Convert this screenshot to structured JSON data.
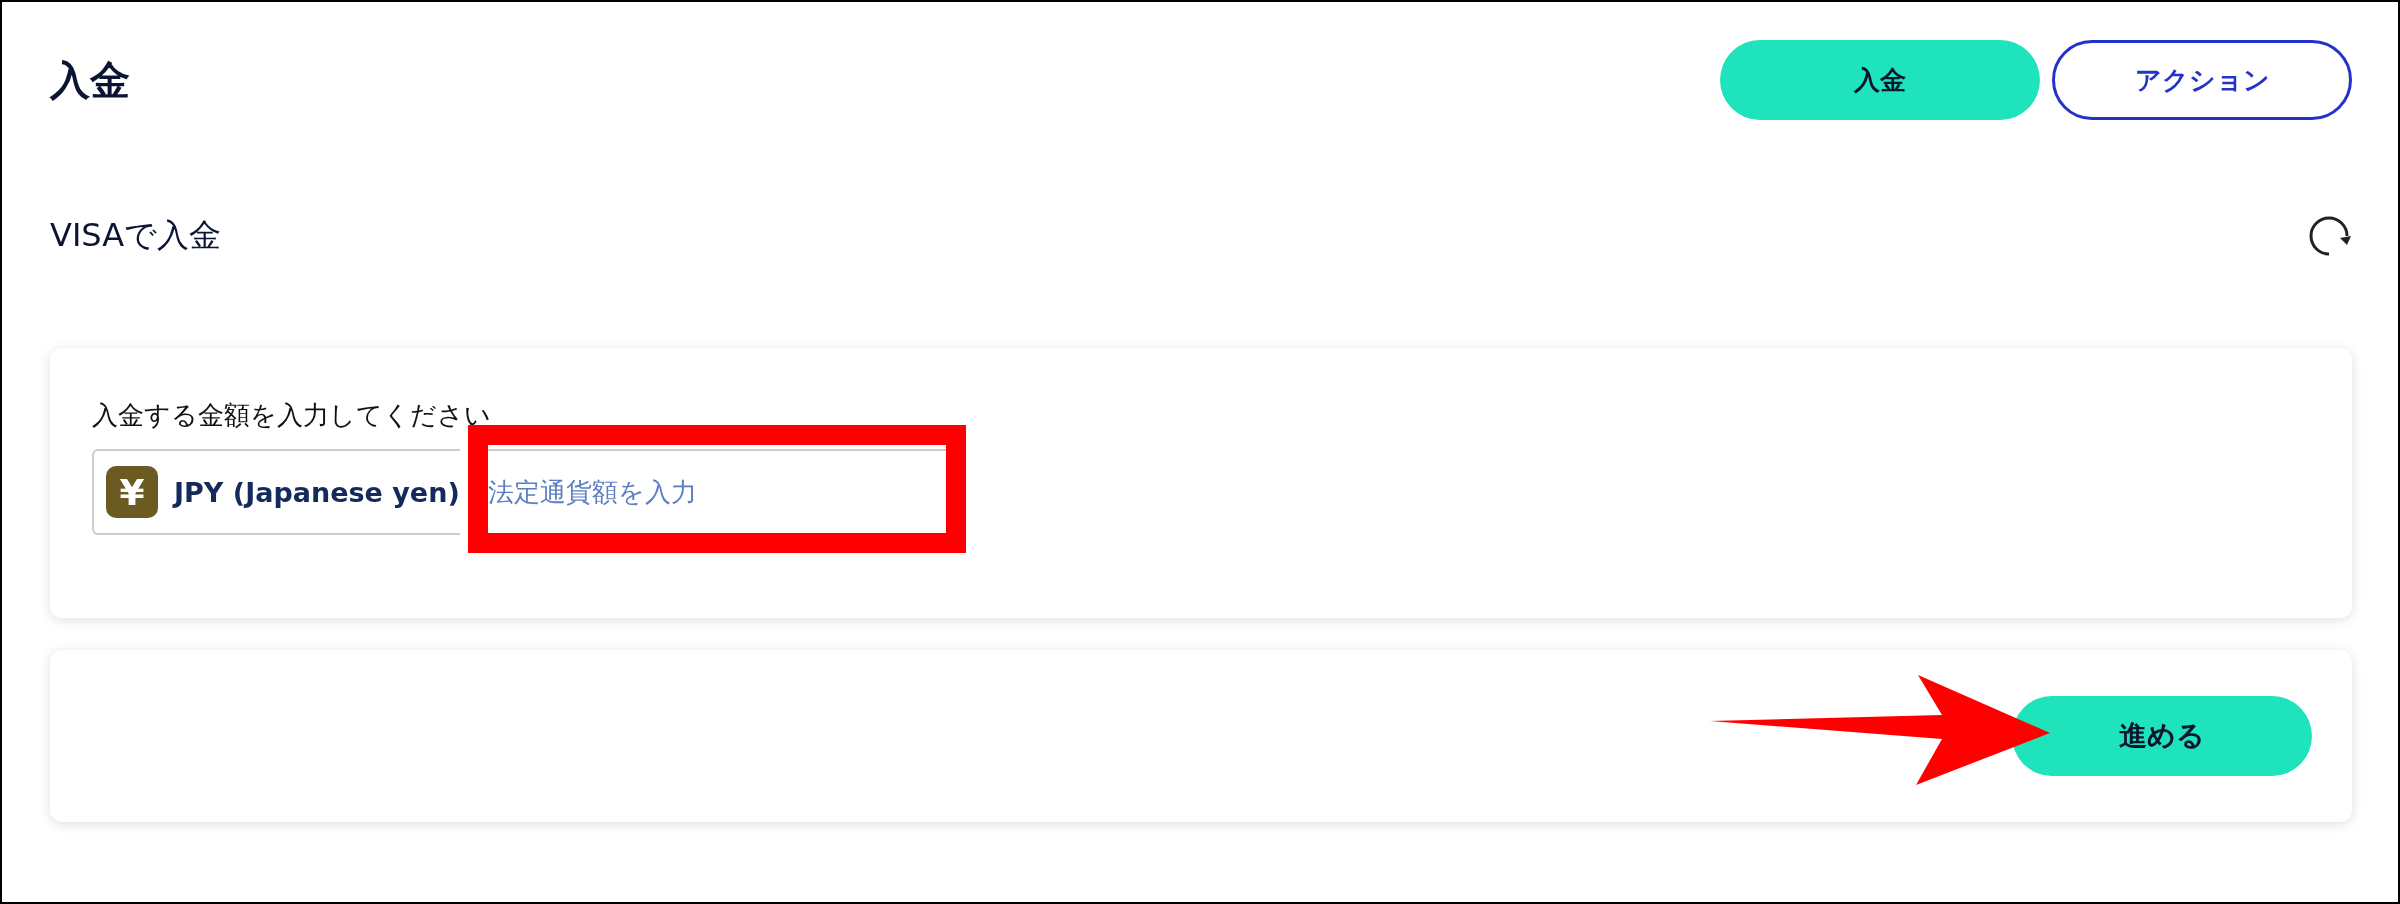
{
  "header": {
    "title": "入金",
    "buttons": [
      {
        "label": "入金",
        "kind": "primary"
      },
      {
        "label": "アクション",
        "kind": "outline"
      }
    ]
  },
  "section": {
    "title": "VISAで入金"
  },
  "amount_card": {
    "label": "入金する金額を入力してください",
    "currency": {
      "symbol": "¥",
      "name": "JPY (Japanese yen)"
    },
    "amount_field": {
      "placeholder": "法定通貨額を入力"
    }
  },
  "footer_card": {
    "button": "進める"
  }
}
